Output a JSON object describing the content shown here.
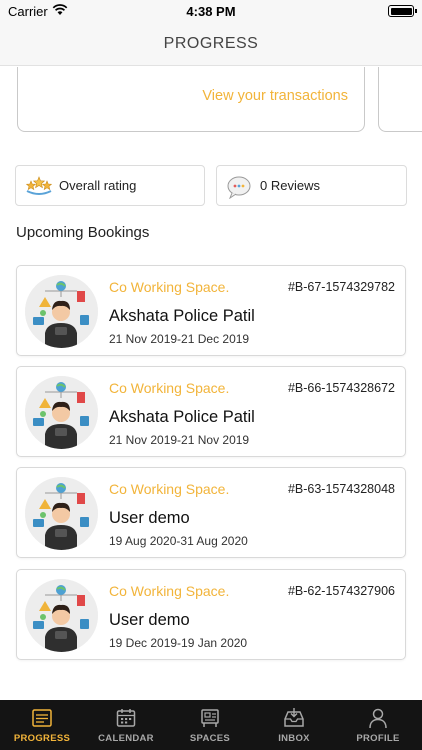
{
  "status_bar": {
    "carrier": "Carrier",
    "time": "4:38 PM"
  },
  "header": {
    "title": "PROGRESS"
  },
  "transactions": {
    "link_label": "View your transactions"
  },
  "stats": {
    "rating_label": "Overall rating",
    "reviews_label": "0 Reviews"
  },
  "section": {
    "title": "Upcoming Bookings"
  },
  "bookings": [
    {
      "space": "Co Working Space.",
      "id": "#B-67-1574329782",
      "name": "Akshata Police Patil",
      "dates": "21 Nov 2019-21 Dec 2019"
    },
    {
      "space": "Co Working Space.",
      "id": "#B-66-1574328672",
      "name": "Akshata Police Patil",
      "dates": "21 Nov 2019-21 Nov 2019"
    },
    {
      "space": "Co Working Space.",
      "id": "#B-63-1574328048",
      "name": "User demo",
      "dates": "19 Aug 2020-31 Aug 2020"
    },
    {
      "space": "Co Working Space.",
      "id": "#B-62-1574327906",
      "name": "User demo",
      "dates": "19 Dec 2019-19 Jan 2020"
    }
  ],
  "tabbar": {
    "items": [
      {
        "label": "PROGRESS",
        "icon": "progress-icon",
        "active": true
      },
      {
        "label": "CALENDAR",
        "icon": "calendar-icon",
        "active": false
      },
      {
        "label": "SPACES",
        "icon": "spaces-icon",
        "active": false
      },
      {
        "label": "INBOX",
        "icon": "inbox-icon",
        "active": false
      },
      {
        "label": "PROFILE",
        "icon": "profile-icon",
        "active": false
      }
    ]
  },
  "colors": {
    "accent": "#f2b43a",
    "tabbar_bg": "#141414",
    "tab_inactive": "#a8a8a8"
  }
}
